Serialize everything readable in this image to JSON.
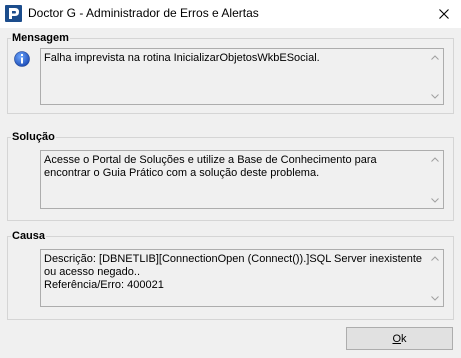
{
  "window": {
    "title": "Doctor G - Administrador de Erros e Alertas"
  },
  "message_group": {
    "legend": "Mensagem",
    "text": "Falha imprevista na rotina InicializarObjetosWkbESocial."
  },
  "solution_group": {
    "legend": "Solução",
    "text": "Acesse o Portal de Soluções e utilize a Base de Conhecimento para encontrar o Guia Prático com a solução deste problema."
  },
  "cause_group": {
    "legend": "Causa",
    "text": "Descrição: [DBNETLIB][ConnectionOpen (Connect()).]SQL Server inexistente ou acesso negado..\nReferência/Erro: 400021"
  },
  "ok_button": {
    "label": "Ok",
    "mnemonic_char": "O",
    "rest": "k"
  },
  "icons": {
    "app": "doctor-g-app-icon",
    "message": "info-icon",
    "close": "close-icon"
  }
}
